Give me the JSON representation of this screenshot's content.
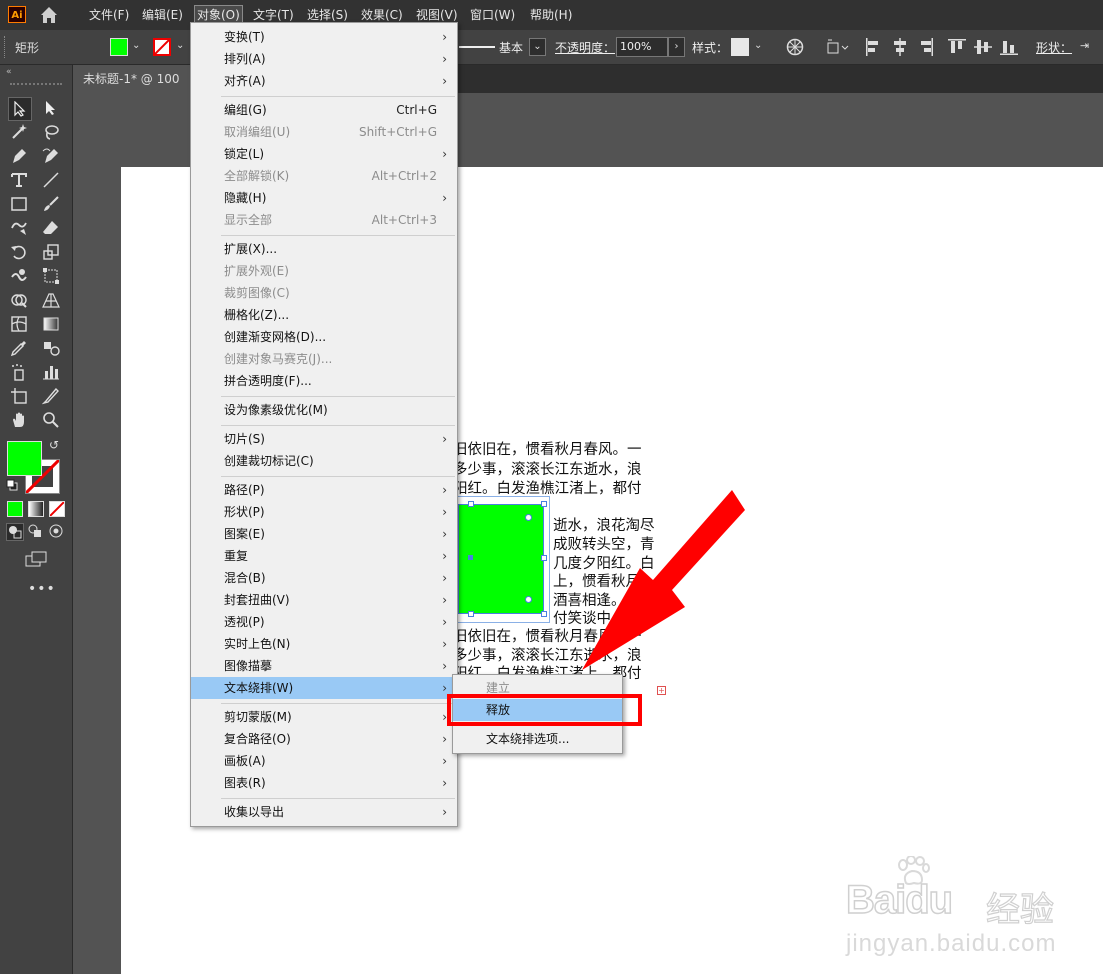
{
  "menubar": {
    "logo": "Ai",
    "items": [
      "文件(F)",
      "编辑(E)",
      "对象(O)",
      "文字(T)",
      "选择(S)",
      "效果(C)",
      "视图(V)",
      "窗口(W)",
      "帮助(H)"
    ]
  },
  "control_bar": {
    "object_type": "矩形",
    "stroke_style": "基本",
    "opacity_label": "不透明度：",
    "opacity_value": "100%",
    "style_label": "样式：",
    "shape_label": "形状："
  },
  "document_tab": {
    "title": "未标题-1* @ 100 %"
  },
  "object_menu": [
    {
      "label": "变换(T)",
      "submenu": true
    },
    {
      "label": "排列(A)",
      "submenu": true
    },
    {
      "label": "对齐(A)",
      "submenu": true
    },
    {
      "label": "编组(G)",
      "shortcut": "Ctrl+G"
    },
    {
      "label": "取消编组(U)",
      "shortcut": "Shift+Ctrl+G",
      "disabled": true
    },
    {
      "label": "锁定(L)",
      "submenu": true
    },
    {
      "label": "全部解锁(K)",
      "shortcut": "Alt+Ctrl+2",
      "disabled": true
    },
    {
      "label": "隐藏(H)",
      "submenu": true
    },
    {
      "label": "显示全部",
      "shortcut": "Alt+Ctrl+3",
      "disabled": true
    },
    {
      "label": "扩展(X)..."
    },
    {
      "label": "扩展外观(E)",
      "disabled": true
    },
    {
      "label": "裁剪图像(C)",
      "disabled": true
    },
    {
      "label": "栅格化(Z)..."
    },
    {
      "label": "创建渐变网格(D)..."
    },
    {
      "label": "创建对象马赛克(J)...",
      "disabled": true
    },
    {
      "label": "拼合透明度(F)..."
    },
    {
      "label": "设为像素级优化(M)"
    },
    {
      "label": "切片(S)",
      "submenu": true
    },
    {
      "label": "创建裁切标记(C)"
    },
    {
      "label": "路径(P)",
      "submenu": true
    },
    {
      "label": "形状(P)",
      "submenu": true
    },
    {
      "label": "图案(E)",
      "submenu": true
    },
    {
      "label": "重复",
      "submenu": true
    },
    {
      "label": "混合(B)",
      "submenu": true
    },
    {
      "label": "封套扭曲(V)",
      "submenu": true
    },
    {
      "label": "透视(P)",
      "submenu": true
    },
    {
      "label": "实时上色(N)",
      "submenu": true
    },
    {
      "label": "图像描摹",
      "submenu": true
    },
    {
      "label": "文本绕排(W)",
      "submenu": true,
      "highlighted": true
    },
    {
      "label": "剪切蒙版(M)",
      "submenu": true
    },
    {
      "label": "复合路径(O)",
      "submenu": true
    },
    {
      "label": "画板(A)",
      "submenu": true
    },
    {
      "label": "图表(R)",
      "submenu": true
    },
    {
      "label": "收集以导出",
      "submenu": true
    }
  ],
  "text_wrap_submenu": [
    {
      "label": "建立",
      "disabled": true
    },
    {
      "label": "释放",
      "highlighted": true
    },
    {
      "label": "文本绕排选项..."
    }
  ],
  "artboard_text": {
    "block1": [
      "旧依旧在，惯看秋月春风。一",
      "多少事，滚滚长江东逝水，浪",
      "阳红。白发渔樵江渚上，都付"
    ],
    "block2": [
      "逝水，浪花淘尽",
      "成败转头空，青",
      "几度夕阳红。白",
      "上，惯看秋月",
      "酒喜相逢。",
      "付笑谈中。"
    ],
    "block3": [
      "旧依旧在，惯看秋月春风。一",
      "多少事，滚滚长江东逝水，浪",
      "阳红。白发渔樵江渚上，都付"
    ]
  },
  "watermark": {
    "brand": "Bai",
    "brand2": "du",
    "cn": "经验",
    "url": "jingyan.baidu.com"
  },
  "colors": {
    "fill": "#00ff00",
    "highlight": "#99c9f5",
    "annotation": "#ff0000"
  }
}
